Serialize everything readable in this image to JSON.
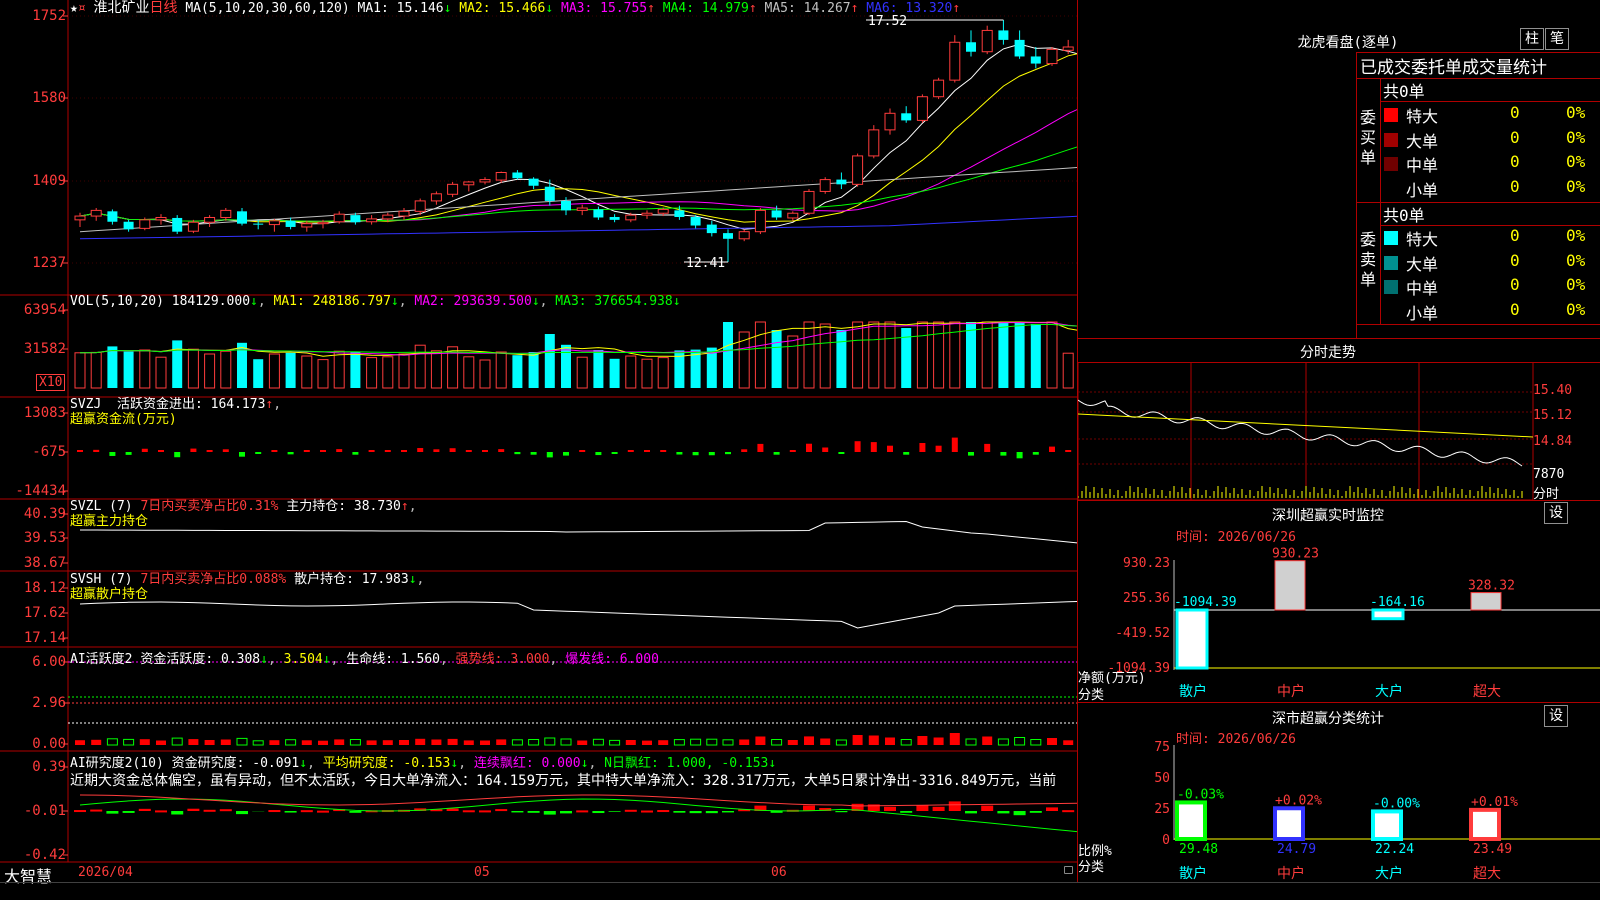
{
  "header": {
    "stock_name": "淮北矿业",
    "period": "日线",
    "ma_label": "MA(5,10,20,30,60,120)",
    "ma_items": [
      {
        "label": "MA1: 15.146",
        "arrow": "↓",
        "color": "#ffffff"
      },
      {
        "label": "MA2: 15.466",
        "arrow": "↓",
        "color": "#ffff00"
      },
      {
        "label": "MA3: 15.755",
        "arrow": "↑",
        "color": "#ff00ff"
      },
      {
        "label": "MA4: 14.979",
        "arrow": "↑",
        "color": "#00ff00"
      },
      {
        "label": "MA5: 14.267",
        "arrow": "↑",
        "color": "#c0c0c0"
      },
      {
        "label": "MA6: 13.320",
        "arrow": "↑",
        "color": "#3232ff"
      }
    ]
  },
  "main_chart": {
    "y_ticks": [
      "1752",
      "1580",
      "1409",
      "1237"
    ],
    "high_label": "17.52",
    "low_label": "12.41"
  },
  "volume": {
    "title": "VOL(5,10,20)",
    "value": "184129.000",
    "ma1": "MA1: 248186.797",
    "ma2": "MA2: 293639.500",
    "ma3": "MA3: 376654.938",
    "y_ticks": [
      "63954",
      "31582"
    ],
    "unit": "X10"
  },
  "svzj": {
    "title": "SVZJ",
    "label": "活跃资金进出: 164.173",
    "subtitle": "超赢资金流(万元)",
    "y_ticks": [
      "13083",
      "-675",
      "-14434"
    ]
  },
  "svzl": {
    "title": "SVZL (7)",
    "ratio_label": "7日内买卖净占比0.31%",
    "hold_label": "主力持仓: 38.730",
    "subtitle": "超赢主力持仓",
    "y_ticks": [
      "40.39",
      "39.53",
      "38.67"
    ]
  },
  "svsh": {
    "title": "SVSH (7)",
    "ratio_label": "7日内买卖净占比0.088%",
    "hold_label": "散户持仓: 17.983",
    "subtitle": "超赢散户持仓",
    "y_ticks": [
      "18.12",
      "17.62",
      "17.14"
    ]
  },
  "ai_active": {
    "title": "AI活跃度2",
    "active_label": "资金活跃度: 0.308",
    "v2": "3.504",
    "life_label": "生命线: 1.560",
    "strong_label": "强势线: 3.000",
    "burst_label": "爆发线: 6.000",
    "y_ticks": [
      "6.00",
      "2.96",
      "0.00"
    ]
  },
  "ai_research": {
    "title": "AI研究度2(10)",
    "research_label": "资金研究度: -0.091",
    "avg_label": "平均研究度: -0.153",
    "red_label": "连续飘红: 0.000",
    "nday_label": "N日飘红: 1.000, -0.153",
    "comment": "近期大资金总体偏空，虽有异动，但不太活跃，今日大单净流入：164.159万元，其中特大单净流入：328.317万元，大单5日累计净出-3316.849万元，当前",
    "y_ticks": [
      "0.39",
      "-0.01",
      "-0.42"
    ]
  },
  "bottom_bar": {
    "brand": "大智慧",
    "date_start": "2026/04",
    "month_05": "05",
    "month_06": "06"
  },
  "dragon_tiger": {
    "title": "龙虎看盘(逐单)",
    "btn_column": "柱",
    "btn_stroke": "笔",
    "stats_title": "已成交委托单成交量统计",
    "buy_group": "委买单",
    "sell_group": "委卖单",
    "buy_total": "共0单",
    "sell_total": "共0单",
    "buy_rows": [
      {
        "label": "特大",
        "value": "0",
        "pct": "0%",
        "color": "#ff0000"
      },
      {
        "label": "大单",
        "value": "0",
        "pct": "0%",
        "color": "#a00000"
      },
      {
        "label": "中单",
        "value": "0",
        "pct": "0%",
        "color": "#700000"
      },
      {
        "label": "小单",
        "value": "0",
        "pct": "0%",
        "color": ""
      }
    ],
    "sell_rows": [
      {
        "label": "特大",
        "value": "0",
        "pct": "0%",
        "color": "#00ffff"
      },
      {
        "label": "大单",
        "value": "0",
        "pct": "0%",
        "color": "#009090"
      },
      {
        "label": "中单",
        "value": "0",
        "pct": "0%",
        "color": "#007070"
      },
      {
        "label": "小单",
        "value": "0",
        "pct": "0%",
        "color": ""
      }
    ]
  },
  "intraday": {
    "title": "分时走势",
    "y_ticks": [
      "15.40",
      "15.12",
      "14.84"
    ],
    "vol_label": "7870",
    "time_label": "分时"
  },
  "sz_monitor": {
    "title": "深圳超赢实时监控",
    "btn": "设",
    "time_label": "时间: 2026/06/26",
    "y_ticks": [
      "930.23",
      "255.36",
      "-419.52",
      "-1094.39"
    ],
    "unit_label": "净额(万元)",
    "cat_label": "分类",
    "categories": [
      "散户",
      "中户",
      "大户",
      "超大"
    ],
    "values": [
      -1094.39,
      930.23,
      -164.16,
      328.32
    ],
    "value_labels": [
      "-1094.39",
      "930.23",
      "-164.16",
      "328.32"
    ]
  },
  "sz_class": {
    "title": "深市超赢分类统计",
    "btn": "设",
    "time_label": "时间: 2026/06/26",
    "y_ticks": [
      "75",
      "50",
      "25",
      "0"
    ],
    "ratio_label": "比例%",
    "cat_label": "分类",
    "categories": [
      "散户",
      "中户",
      "大户",
      "超大"
    ],
    "values": [
      29.48,
      24.79,
      22.24,
      23.49
    ],
    "value_labels": [
      "29.48",
      "24.79",
      "22.24",
      "23.49"
    ],
    "change_labels": [
      "-0.03%",
      "+0.02%",
      "-0.00%",
      "+0.01%"
    ]
  },
  "chart_data": {
    "type": "candlestick",
    "title": "淮北矿业 日线",
    "ohlc": [
      [
        13.3,
        13.45,
        13.15,
        13.38
      ],
      [
        13.38,
        13.55,
        13.28,
        13.5
      ],
      [
        13.48,
        13.52,
        13.2,
        13.26
      ],
      [
        13.26,
        13.3,
        13.05,
        13.1
      ],
      [
        13.12,
        13.35,
        13.08,
        13.3
      ],
      [
        13.3,
        13.42,
        13.2,
        13.35
      ],
      [
        13.34,
        13.4,
        13.0,
        13.05
      ],
      [
        13.06,
        13.3,
        13.02,
        13.25
      ],
      [
        13.25,
        13.4,
        13.15,
        13.35
      ],
      [
        13.35,
        13.55,
        13.28,
        13.5
      ],
      [
        13.48,
        13.55,
        13.18,
        13.22
      ],
      [
        13.22,
        13.3,
        13.1,
        13.2
      ],
      [
        13.2,
        13.32,
        13.05,
        13.28
      ],
      [
        13.28,
        13.35,
        13.1,
        13.15
      ],
      [
        13.15,
        13.28,
        13.05,
        13.22
      ],
      [
        13.22,
        13.3,
        13.12,
        13.25
      ],
      [
        13.26,
        13.48,
        13.22,
        13.42
      ],
      [
        13.4,
        13.45,
        13.2,
        13.25
      ],
      [
        13.26,
        13.4,
        13.2,
        13.32
      ],
      [
        13.32,
        13.45,
        13.25,
        13.4
      ],
      [
        13.38,
        13.55,
        13.3,
        13.48
      ],
      [
        13.48,
        13.75,
        13.4,
        13.7
      ],
      [
        13.7,
        13.9,
        13.62,
        13.85
      ],
      [
        13.84,
        14.1,
        13.78,
        14.05
      ],
      [
        14.04,
        14.12,
        13.9,
        14.1
      ],
      [
        14.1,
        14.2,
        14.05,
        14.15
      ],
      [
        14.14,
        14.32,
        14.08,
        14.3
      ],
      [
        14.3,
        14.35,
        14.15,
        14.18
      ],
      [
        14.17,
        14.2,
        13.95,
        14.02
      ],
      [
        14.0,
        14.15,
        13.6,
        13.7
      ],
      [
        13.7,
        13.78,
        13.4,
        13.5
      ],
      [
        13.5,
        13.62,
        13.4,
        13.55
      ],
      [
        13.52,
        13.58,
        13.3,
        13.35
      ],
      [
        13.36,
        13.42,
        13.25,
        13.3
      ],
      [
        13.3,
        13.45,
        13.25,
        13.4
      ],
      [
        13.4,
        13.5,
        13.32,
        13.44
      ],
      [
        13.44,
        13.56,
        13.38,
        13.52
      ],
      [
        13.5,
        13.6,
        13.3,
        13.36
      ],
      [
        13.36,
        13.4,
        13.12,
        13.18
      ],
      [
        13.2,
        13.28,
        12.95,
        13.02
      ],
      [
        13.02,
        13.1,
        12.41,
        12.9
      ],
      [
        12.9,
        13.1,
        12.85,
        13.05
      ],
      [
        13.05,
        13.55,
        13.0,
        13.5
      ],
      [
        13.5,
        13.6,
        13.3,
        13.35
      ],
      [
        13.34,
        13.48,
        13.28,
        13.44
      ],
      [
        13.44,
        13.95,
        13.4,
        13.9
      ],
      [
        13.9,
        14.2,
        13.85,
        14.15
      ],
      [
        14.15,
        14.3,
        13.95,
        14.05
      ],
      [
        14.05,
        14.7,
        14.0,
        14.65
      ],
      [
        14.65,
        15.3,
        14.6,
        15.2
      ],
      [
        15.2,
        15.65,
        15.1,
        15.55
      ],
      [
        15.55,
        15.7,
        15.35,
        15.4
      ],
      [
        15.4,
        15.95,
        15.35,
        15.9
      ],
      [
        15.9,
        16.3,
        15.85,
        16.25
      ],
      [
        16.25,
        17.2,
        16.2,
        17.05
      ],
      [
        17.05,
        17.3,
        16.75,
        16.85
      ],
      [
        16.85,
        17.4,
        16.8,
        17.3
      ],
      [
        17.3,
        17.52,
        17.0,
        17.1
      ],
      [
        17.1,
        17.3,
        16.7,
        16.75
      ],
      [
        16.75,
        16.95,
        16.5,
        16.6
      ],
      [
        16.6,
        16.95,
        16.55,
        16.9
      ],
      [
        16.88,
        17.1,
        16.8,
        16.95
      ],
      [
        16.95,
        17.05,
        16.55,
        16.65
      ],
      [
        16.65,
        16.75,
        16.15,
        16.3
      ],
      [
        16.28,
        16.35,
        15.85,
        15.95
      ],
      [
        15.95,
        16.3,
        15.9,
        16.1
      ],
      [
        16.12,
        16.2,
        15.85,
        15.95
      ],
      [
        15.95,
        16.05,
        15.55,
        15.65
      ],
      [
        15.65,
        15.9,
        15.55,
        15.8
      ],
      [
        15.8,
        16.05,
        15.75,
        15.95
      ],
      [
        15.95,
        16.05,
        15.55,
        15.6
      ],
      [
        15.6,
        15.8,
        15.45,
        15.7
      ],
      [
        15.7,
        15.78,
        15.2,
        15.25
      ]
    ]
  }
}
